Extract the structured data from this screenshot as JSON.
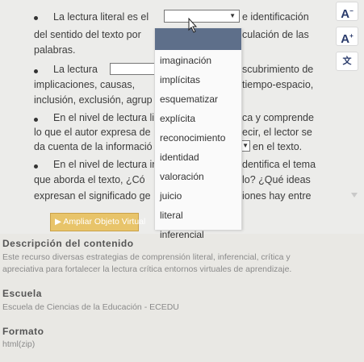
{
  "paragraphs": {
    "p1_line1_pre": "La lectura literal es el",
    "p1_line1_post": "e identificación",
    "p1_line2_pre": "del sentido del texto por",
    "p1_line2_post": "culación de las",
    "p1_line3": "palabras.",
    "p2_line1_pre": "La lectura",
    "p2_line1_post": "scubrimiento de",
    "p2_line2_pre": "implicaciones, causas,",
    "p2_line2_post": "tiempo-espacio,",
    "p2_line3": "inclusión, exclusión, agrup",
    "p3_line1": "En el nivel de lectura lit",
    "p3_line1_post": "ca y comprende",
    "p3_line2": "lo que el autor expresa de",
    "p3_line2_post": "ecir, el lector se",
    "p3_line3": "da cuenta de la informació",
    "p3_line3_post": "en el texto.",
    "p4_line1": "En el nivel de lectura ir",
    "p4_line1_post": "dentifica el tema",
    "p4_line2": "que aborda el texto, ¿Có",
    "p4_line2_post": "lo? ¿Qué ideas",
    "p4_line3": "expresan el significado ge",
    "p4_line3_post": "iones hay entre"
  },
  "dropdown": {
    "options": [
      "imaginación",
      "implícitas",
      "esquematizar",
      "explícita",
      "reconocimiento",
      "identidad",
      "valoración",
      "juicio",
      "literal",
      "inferencial"
    ]
  },
  "expand_button": {
    "label": "▶ Ampliar Objeto Virtual"
  },
  "sidebar": {
    "font_decrease": "A",
    "font_increase": "A",
    "translate_icon": "translate-icon"
  },
  "description": {
    "title": "Descripción del contenido",
    "line1": "Este recurso diversas estrategias de comprensión literal, inferencial, crítica y",
    "line2": "apreciativa para fortalecer la lectura crítica entornos virtuales de aprendizaje."
  },
  "school": {
    "title": "Escuela",
    "value": "Escuela de Ciencias de la Educación - ECEDU"
  },
  "format": {
    "title": "Formato",
    "value": "html(zip)"
  },
  "colors": {
    "dropdown_header": "#5e6f8a",
    "expand_button": "#e8c46a",
    "sidebar_text": "#2a3b6b"
  }
}
